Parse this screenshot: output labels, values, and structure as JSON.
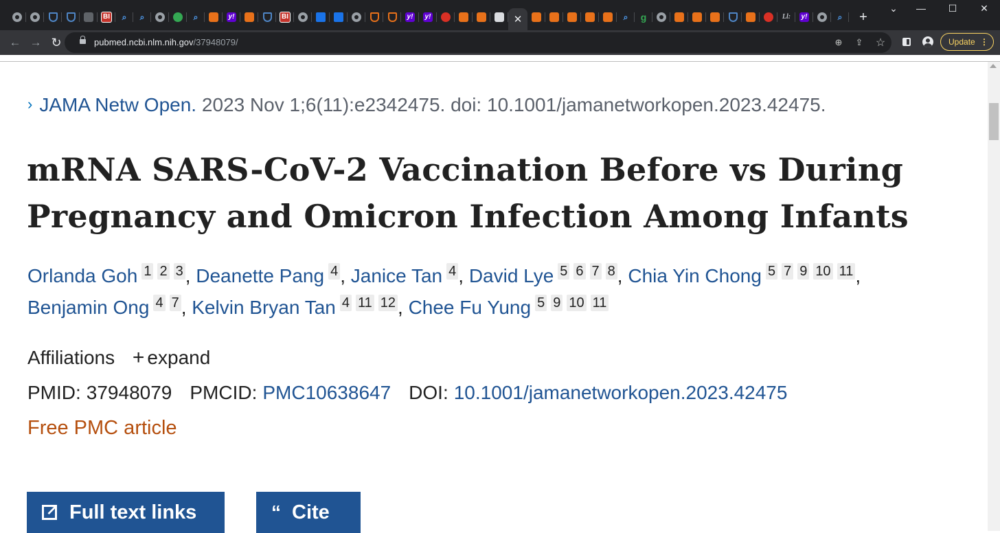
{
  "browser": {
    "tab_favicons": [
      "globe",
      "globe",
      "shield",
      "shield",
      "play-arrow",
      "bi",
      "search",
      "search",
      "globe",
      "play",
      "search",
      "bookmark",
      "yahoo",
      "bookmark",
      "shield",
      "bi",
      "globe",
      "cube",
      "cube",
      "globe",
      "subscribe",
      "subscribe",
      "yahoo",
      "yahoo",
      "podcast",
      "bookmark",
      "bookmark",
      "nytimes",
      "bookmark",
      "bookmark",
      "bookmark",
      "bookmark",
      "bookmark",
      "search",
      "grammarly",
      "globe",
      "bookmark",
      "bookmark",
      "bookmark",
      "shield",
      "bookmark",
      "podcast",
      "ll",
      "yahoo",
      "globe",
      "search"
    ],
    "bi_label": "BI",
    "yahoo_label": "y!",
    "grammarly_label": "g",
    "ll_label": "Ll:",
    "active_tab_close": "✕",
    "new_tab": "+",
    "url_host": "pubmed.ncbi.nlm.nih.gov",
    "url_path": "/37948079/",
    "update_label": "Update",
    "update_menu": "⋮",
    "back_glyph": "←",
    "forward_glyph": "→",
    "reload_glyph": "↻",
    "zoom_glyph": "⊕",
    "share_glyph": "⇪",
    "star_glyph": "☆",
    "minimize_glyph": "—",
    "maximize_glyph": "☐",
    "close_glyph": "✕",
    "collapse_glyph": "⌄"
  },
  "article": {
    "chevron": "›",
    "journal": "JAMA Netw Open.",
    "citation": " 2023 Nov 1;6(11):e2342475. doi: 10.1001/jamanetworkopen.2023.42475.",
    "title": "mRNA SARS-CoV-2 Vaccination Before vs During Pregnancy and Omicron Infection Among Infants",
    "authors": [
      {
        "name": "Orlanda Goh",
        "affs": [
          "1",
          "2",
          "3"
        ]
      },
      {
        "name": "Deanette Pang",
        "affs": [
          "4"
        ]
      },
      {
        "name": "Janice Tan",
        "affs": [
          "4"
        ]
      },
      {
        "name": "David Lye",
        "affs": [
          "5",
          "6",
          "7",
          "8"
        ]
      },
      {
        "name": "Chia Yin Chong",
        "affs": [
          "5",
          "7",
          "9",
          "10",
          "11"
        ]
      },
      {
        "name": "Benjamin Ong",
        "affs": [
          "4",
          "7"
        ]
      },
      {
        "name": "Kelvin Bryan Tan",
        "affs": [
          "4",
          "11",
          "12"
        ]
      },
      {
        "name": "Chee Fu Yung",
        "affs": [
          "5",
          "9",
          "10",
          "11"
        ]
      }
    ],
    "affiliations_label": "Affiliations",
    "expand_plus": "+",
    "expand_label": "expand",
    "pmid_label": "PMID:",
    "pmid": "37948079",
    "pmcid_label": "PMCID:",
    "pmcid": "PMC10638647",
    "doi_label": "DOI:",
    "doi": "10.1001/jamanetworkopen.2023.42475",
    "free_pmc": "Free PMC article",
    "full_text_label": "Full text links",
    "cite_quote": "“",
    "cite_label": "Cite"
  },
  "colors": {
    "link": "#205493",
    "accent_free": "#b54f0e",
    "button_bg": "#205493",
    "update_border": "#fdd663"
  }
}
